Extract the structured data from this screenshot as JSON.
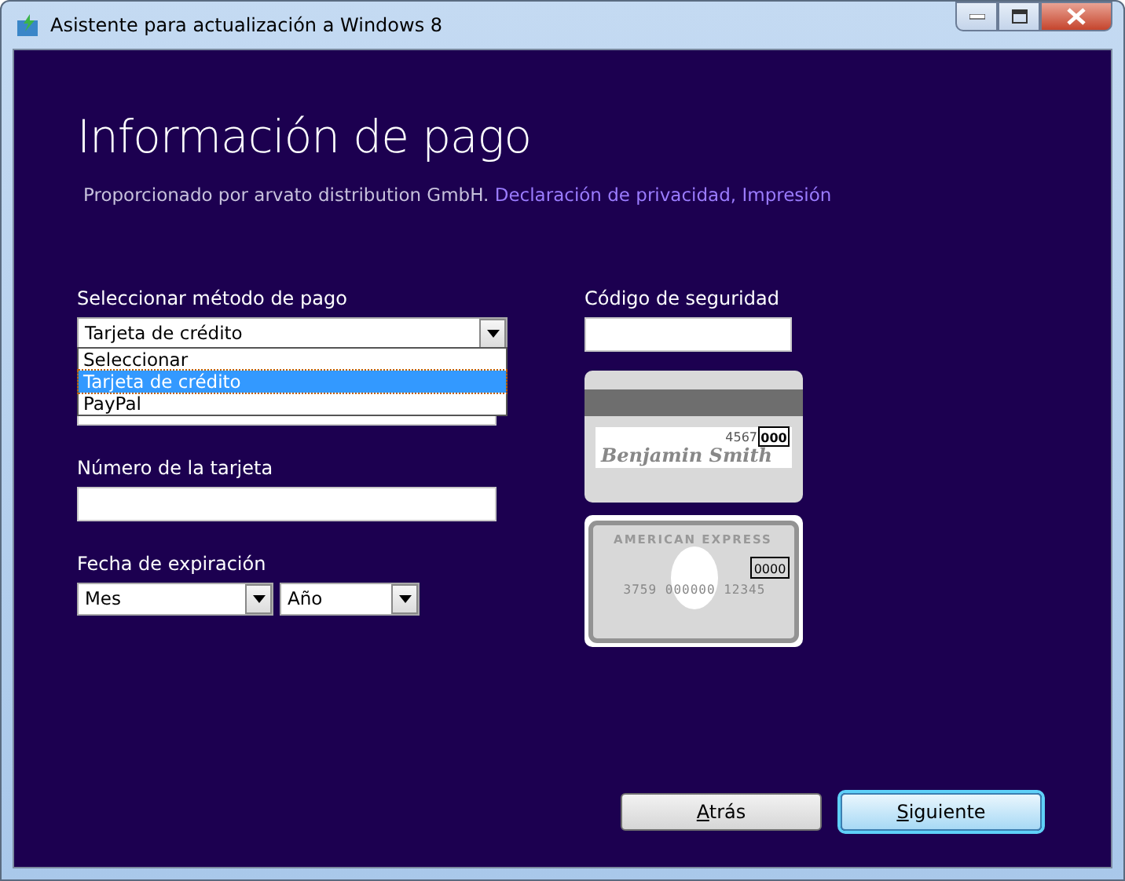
{
  "window": {
    "title": "Asistente para actualización a Windows 8"
  },
  "heading": "Información de pago",
  "subtitle": {
    "text": "Proporcionado por arvato distribution GmbH.",
    "links": [
      "Declaración de privacidad,",
      "Impresión"
    ]
  },
  "payment_method": {
    "label": "Seleccionar método de pago",
    "value": "Tarjeta de crédito",
    "expanded": true,
    "options": [
      {
        "label": "Seleccionar",
        "selected": false
      },
      {
        "label": "Tarjeta de crédito",
        "selected": true
      },
      {
        "label": "PayPal",
        "selected": false
      }
    ]
  },
  "card_number": {
    "label": "Número de la tarjeta"
  },
  "expiration": {
    "label": "Fecha de expiración",
    "month": "Mes",
    "year": "Año"
  },
  "security_code": {
    "label": "Código de seguridad"
  },
  "card_back": {
    "digits": "4567",
    "code": "000",
    "name": "Benjamin Smith"
  },
  "card_amex": {
    "brand": "AMERICAN EXPRESS",
    "code": "0000",
    "number": "3759 000000 12345"
  },
  "buttons": [
    {
      "label": "Atrás",
      "focused": false
    },
    {
      "label": "Siguiente",
      "focused": true
    }
  ]
}
